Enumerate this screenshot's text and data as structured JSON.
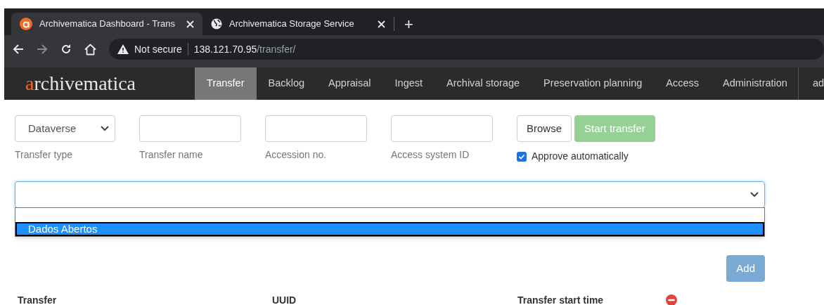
{
  "browser_tabs": [
    {
      "title": "Archivematica Dashboard - Trans",
      "selected": true
    },
    {
      "title": "Archivematica Storage Service",
      "selected": false
    }
  ],
  "new_tab": "+",
  "address_bar": {
    "security": "Not secure",
    "host": "138.121.70.95",
    "path": "/transfer/"
  },
  "navbar": {
    "logo": "archivematica",
    "items": [
      {
        "label": "Transfer",
        "selected": true
      },
      {
        "label": "Backlog",
        "selected": false
      },
      {
        "label": "Appraisal",
        "selected": false
      },
      {
        "label": "Ingest",
        "selected": false
      },
      {
        "label": "Archival storage",
        "selected": false
      },
      {
        "label": "Preservation planning",
        "selected": false
      },
      {
        "label": "Access",
        "selected": false
      },
      {
        "label": "Administration",
        "selected": false
      }
    ],
    "user": "ad"
  },
  "form": {
    "transfer_type": {
      "value": "Dataverse",
      "label": "Transfer type"
    },
    "fields": [
      {
        "label": "Transfer name"
      },
      {
        "label": "Accession no."
      },
      {
        "label": "Access system ID"
      }
    ],
    "browse_button": "Browse",
    "start_button": {
      "label": "Start transfer",
      "disabled": true
    },
    "approve": {
      "label": "Approve automatically",
      "checked": true
    }
  },
  "source_select": {
    "expanded": true,
    "options": [
      {
        "label": "Dados Abertos",
        "selected": true
      }
    ]
  },
  "add_button": {
    "label": "Add",
    "disabled": true
  },
  "table": {
    "columns": [
      {
        "label": "Transfer"
      },
      {
        "label": "UUID"
      },
      {
        "label": "Transfer start time"
      }
    ]
  }
}
